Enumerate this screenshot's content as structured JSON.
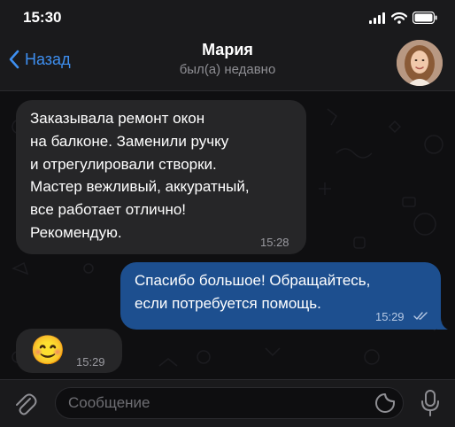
{
  "status_bar": {
    "time": "15:30"
  },
  "header": {
    "back_label": "Назад",
    "contact_name": "Мария",
    "contact_status": "был(а) недавно"
  },
  "messages": [
    {
      "direction": "incoming",
      "text": "Заказывала ремонт окон\nна балконе. Заменили ручку\nи отрегулировали створки.\nМастер вежливый, аккуратный,\nвсе работает отлично!\nРекомендую.",
      "time": "15:28"
    },
    {
      "direction": "outgoing",
      "text": "Спасибо большое! Обращайтесь,\nесли потребуется помощь.",
      "time": "15:29",
      "read": true
    },
    {
      "direction": "incoming",
      "emoji": "😊",
      "time": "15:29"
    }
  ],
  "input_bar": {
    "placeholder": "Сообщение"
  },
  "colors": {
    "accent": "#3e8ff0",
    "outgoing_bubble": "#1d4f8f",
    "incoming_bubble": "#262628",
    "background": "#0f0f11"
  },
  "icons": [
    "signal-icon",
    "wifi-icon",
    "battery-icon",
    "chevron-left-icon",
    "paperclip-icon",
    "sticker-icon",
    "microphone-icon",
    "double-check-icon"
  ]
}
